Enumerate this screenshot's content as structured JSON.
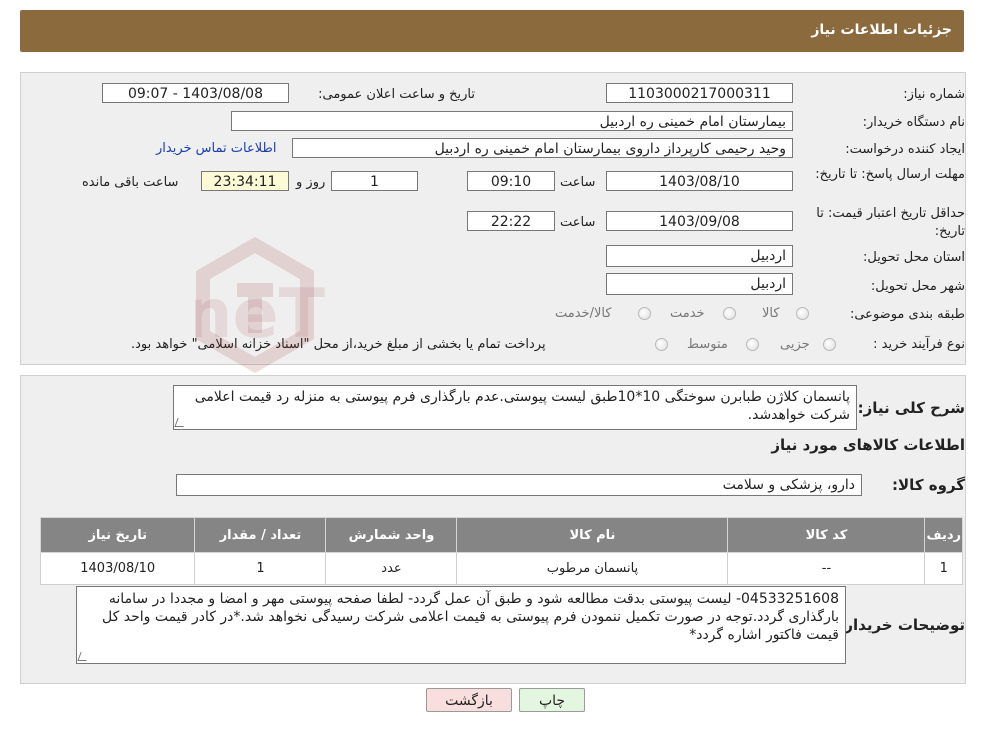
{
  "header": {
    "title": "جزئیات اطلاعات نیاز"
  },
  "info": {
    "need_number_label": "شماره نیاز:",
    "need_number": "1103000217000311",
    "announce_label": "تاریخ و ساعت اعلان عمومی:",
    "announce_value": "1403/08/08 - 09:07",
    "buyer_org_label": "نام دستگاه خریدار:",
    "buyer_org": "بیمارستان امام خمینی  ره  اردبیل",
    "requester_label": "ایجاد کننده درخواست:",
    "requester": "وحید رحیمی کارپرداز داروی  بیمارستان امام خمینی  ره  اردبیل",
    "contact_link": "اطلاعات تماس خریدار",
    "deadline_label": "مهلت ارسال پاسخ: تا تاریخ:",
    "deadline_date": "1403/08/10",
    "time_label": "ساعت",
    "deadline_time": "09:10",
    "days_value": "1",
    "days_label": "روز و",
    "remaining_time": "23:34:11",
    "remaining_label": "ساعت باقی مانده",
    "validity_label": "حداقل تاریخ اعتبار قیمت: تا تاریخ:",
    "validity_date": "1403/09/08",
    "validity_time": "22:22",
    "province_label": "استان محل تحویل:",
    "province": "اردبیل",
    "city_label": "شهر محل تحویل:",
    "city": "اردبیل",
    "category_label": "طبقه بندی موضوعی:",
    "category_options": [
      "کالا",
      "خدمت",
      "کالا/خدمت"
    ],
    "process_label": "نوع فرآیند خرید :",
    "process_options": [
      "جزیی",
      "متوسط"
    ],
    "process_note": "پرداخت تمام یا بخشی از مبلغ خرید،از محل \"اسناد خزانه اسلامی\" خواهد بود."
  },
  "need": {
    "desc_label": "شرح کلی نیاز:",
    "desc": "پانسمان کلاژن طبابرن سوختگی 10*10طبق لیست پیوستی.عدم بارگذاری فرم پیوستی به منزله رد قیمت اعلامی شرکت خواهدشد.",
    "goods_title": "اطلاعات کالاهای مورد نیاز",
    "group_label": "گروه کالا:",
    "group_value": "دارو، پزشکی و سلامت",
    "table": {
      "headers": [
        "ردیف",
        "کد کالا",
        "نام کالا",
        "واحد شمارش",
        "تعداد / مقدار",
        "تاریخ نیاز"
      ],
      "rows": [
        [
          "1",
          "--",
          "پانسمان مرطوب",
          "عدد",
          "1",
          "1403/08/10"
        ]
      ]
    },
    "buyer_notes_label": "توضیحات خریدار:",
    "buyer_notes": "04533251608- لیست پیوستی بدقت مطالعه شود و طبق آن عمل گردد- لطفا صفحه پیوستی مهر و امضا و مجددا در سامانه بارگذاری گردد.توجه در صورت تکمیل ننمودن فرم پیوستی به قیمت اعلامی شرکت رسیدگی نخواهد شد.*در کادر قیمت واحد کل قیمت فاکتور اشاره گردد*"
  },
  "buttons": {
    "print": "چاپ",
    "back": "بازگشت"
  },
  "watermark": {
    "text": "AriaTender.neT"
  },
  "colors": {
    "header": "#8b6a3e",
    "table_header": "#858585",
    "link": "#1a3fb0",
    "back_button": "#f9dede",
    "print_button": "#e3f6df"
  }
}
